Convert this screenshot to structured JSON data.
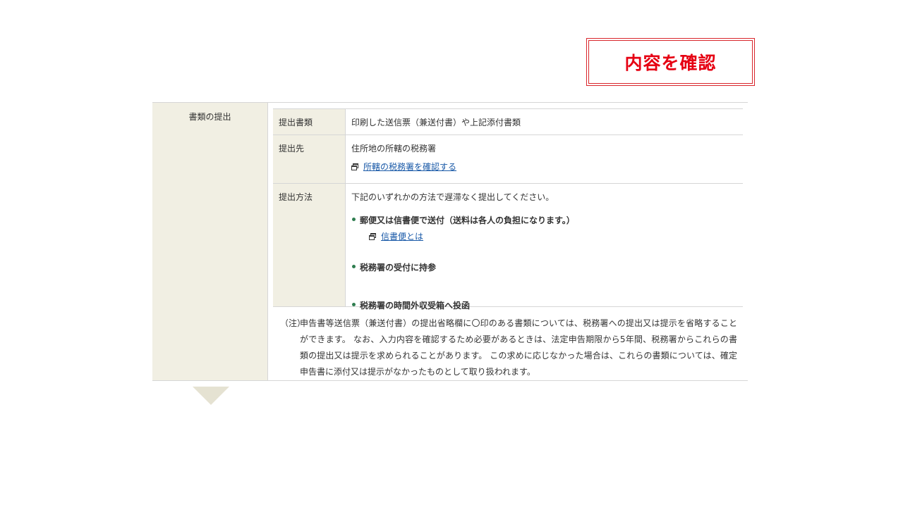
{
  "callout": {
    "label": "内容を確認"
  },
  "section": {
    "title": "書類の提出",
    "rows": [
      {
        "key": "提出書類",
        "value": "印刷した送信票（兼送付書）や上記添付書類"
      },
      {
        "key": "提出先",
        "value": "住所地の所轄の税務署",
        "link_label": "所轄の税務署を確認する"
      },
      {
        "key": "提出方法",
        "value": "下記のいずれかの方法で遅滞なく提出してください。",
        "methods": [
          "郵便又は信書便で送付（送料は各人の負担になります。）",
          "税務署の受付に持参",
          "税務署の時間外収受箱へ投函"
        ],
        "method_link_label": "信書便とは"
      }
    ],
    "note_label": "（注）",
    "note_text": "申告書等送信票（兼送付書）の提出省略欄に〇印のある書類については、税務署への提出又は提示を省略することができます。 なお、入力内容を確認するため必要があるときは、法定申告期限から5年間、税務署からこれらの書類の提出又は提示を求められることがあります。 この求めに応じなかった場合は、これらの書類については、確定申告書に添付又は提示がなかったものとして取り扱われます。"
  },
  "colors": {
    "accent_red": "#e60012",
    "label_bg": "#f1efe3",
    "link": "#1a5aa8",
    "bullet": "#2e7d4f"
  }
}
